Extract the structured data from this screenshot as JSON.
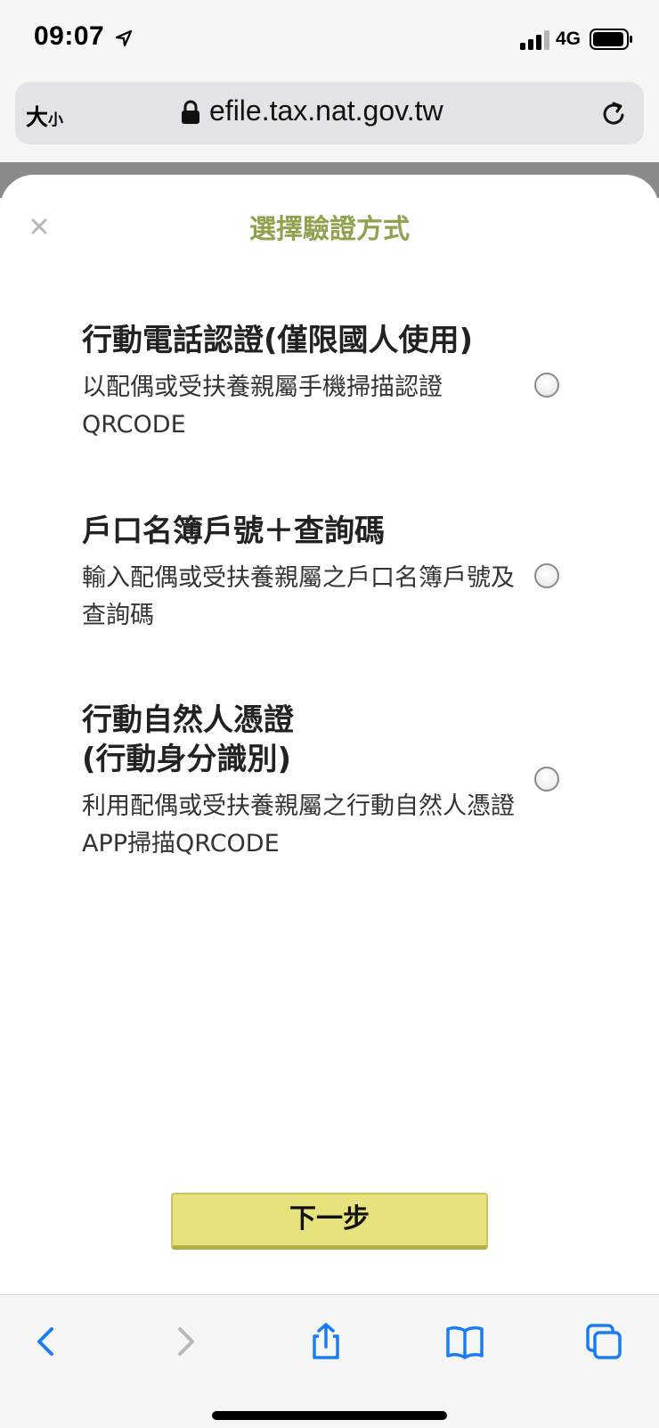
{
  "status_bar": {
    "time": "09:07",
    "network": "4G",
    "icons": [
      "location-arrow-icon",
      "signal-bars-icon",
      "battery-icon"
    ]
  },
  "address_bar": {
    "text_size_label_large": "大",
    "text_size_label_small": "小",
    "url": "efile.tax.nat.gov.tw",
    "icons": [
      "lock-icon",
      "reload-icon"
    ]
  },
  "modal": {
    "title": "選擇驗證方式",
    "close_icon": "close-icon",
    "options": [
      {
        "title": "行動電話認證(僅限國人使用)",
        "description": "以配偶或受扶養親屬手機掃描認證QRCODE",
        "selected": false
      },
      {
        "title": "戶口名簿戶號＋查詢碼",
        "description": "輸入配偶或受扶養親屬之戶口名簿戶號及查詢碼",
        "selected": false
      },
      {
        "title_line1": "行動自然人憑證",
        "title_line2": "(行動身分識別)",
        "description": "利用配偶或受扶養親屬之行動自然人憑證APP掃描QRCODE",
        "selected": false
      }
    ],
    "next_button_label": "下一步"
  },
  "toolbar": {
    "icons": [
      "back-icon",
      "forward-icon",
      "share-icon",
      "bookmarks-icon",
      "tabs-icon"
    ]
  },
  "colors": {
    "title_green": "#8ea34e",
    "button_yellow": "#e6e27c",
    "ios_blue": "#1a7cf5"
  }
}
